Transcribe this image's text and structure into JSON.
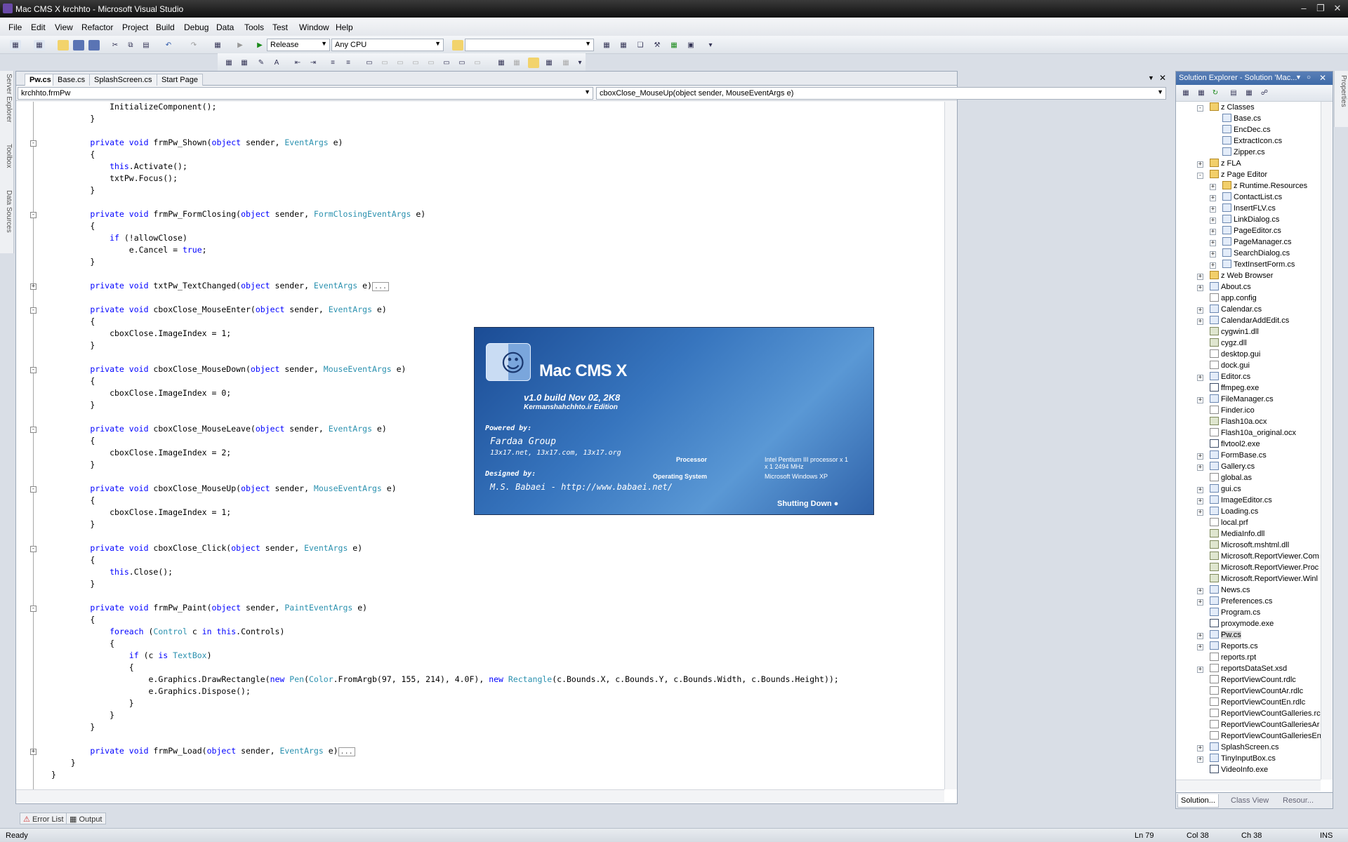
{
  "window": {
    "title": "Mac CMS X krchhto - Microsoft Visual Studio"
  },
  "menu": [
    "File",
    "Edit",
    "View",
    "Refactor",
    "Project",
    "Build",
    "Debug",
    "Data",
    "Tools",
    "Test",
    "Window",
    "Help"
  ],
  "toolbar": {
    "config": "Release",
    "platform": "Any CPU",
    "find": ""
  },
  "side_tabs": [
    "Server Explorer",
    "Toolbox",
    "Data Sources"
  ],
  "document_tabs": [
    "Pw.cs",
    "Base.cs",
    "SplashScreen.cs",
    "Start Page"
  ],
  "navbar": {
    "type": "krchhto.frmPw",
    "member": "cboxClose_MouseUp(object sender, MouseEventArgs e)"
  },
  "code_lines": [
    "            InitializeComponent();",
    "        }",
    "",
    "        private void frmPw_Shown(object sender, EventArgs e)",
    "        {",
    "            this.Activate();",
    "            txtPw.Focus();",
    "        }",
    "",
    "        private void frmPw_FormClosing(object sender, FormClosingEventArgs e)",
    "        {",
    "            if (!allowClose)",
    "                e.Cancel = true;",
    "        }",
    "",
    "        private void txtPw_TextChanged(object sender, EventArgs e)",
    "",
    "        private void cboxClose_MouseEnter(object sender, EventArgs e)",
    "        {",
    "            cboxClose.ImageIndex = 1;",
    "        }",
    "",
    "        private void cboxClose_MouseDown(object sender, MouseEventArgs e)",
    "        {",
    "            cboxClose.ImageIndex = 0;",
    "        }",
    "",
    "        private void cboxClose_MouseLeave(object sender, EventArgs e)",
    "        {",
    "            cboxClose.ImageIndex = 2;",
    "        }",
    "",
    "        private void cboxClose_MouseUp(object sender, MouseEventArgs e)",
    "        {",
    "            cboxClose.ImageIndex = 1;",
    "        }",
    "",
    "        private void cboxClose_Click(object sender, EventArgs e)",
    "        {",
    "            this.Close();",
    "        }",
    "",
    "        private void frmPw_Paint(object sender, PaintEventArgs e)",
    "        {",
    "            foreach (Control c in this.Controls)",
    "            {",
    "                if (c is TextBox)",
    "                {",
    "                    e.Graphics.DrawRectangle(new Pen(Color.FromArgb(97, 155, 214), 4.0F), new Rectangle(c.Bounds.X, c.Bounds.Y, c.Bounds.Width, c.Bounds.Height));",
    "                    e.Graphics.Dispose();",
    "                }",
    "            }",
    "        }",
    "",
    "        private void frmPw_Load(object sender, EventArgs e)",
    "    }",
    "}"
  ],
  "collapsed_marker": "...",
  "splash": {
    "app_name": "Mac CMS X",
    "build": "v1.0 build Nov 02, 2K8",
    "edition": "Kermanshahchhto.ir Edition",
    "powered_by_label": "Powered by:",
    "group": "Fardaa Group",
    "domains": "13x17.net, 13x17.com, 13x17.org",
    "designed_by_label": "Designed by:",
    "designer": "M.S. Babaei - http://www.babaei.net/",
    "processor_label": "Processor",
    "processor": "Intel Pentium III processor x 1",
    "processor_line2": "x 1  2494 MHz",
    "os_label": "Operating System",
    "os": "Microsoft Windows XP",
    "status": "Shutting Down"
  },
  "solution_explorer": {
    "title": "Solution Explorer - Solution 'Mac...",
    "items": [
      {
        "label": "z Classes",
        "type": "folder",
        "level": 1,
        "expander": "minus"
      },
      {
        "label": "Base.cs",
        "type": "cs",
        "level": 2,
        "expander": ""
      },
      {
        "label": "EncDec.cs",
        "type": "cs",
        "level": 2,
        "expander": ""
      },
      {
        "label": "ExtractIcon.cs",
        "type": "cs",
        "level": 2,
        "expander": ""
      },
      {
        "label": "Zipper.cs",
        "type": "cs",
        "level": 2,
        "expander": ""
      },
      {
        "label": "z FLA",
        "type": "folder",
        "level": 1,
        "expander": "plus"
      },
      {
        "label": "z Page Editor",
        "type": "folder",
        "level": 1,
        "expander": "minus"
      },
      {
        "label": "z Runtime.Resources",
        "type": "folder",
        "level": 2,
        "expander": "plus"
      },
      {
        "label": "ContactList.cs",
        "type": "cs",
        "level": 2,
        "expander": "plus"
      },
      {
        "label": "InsertFLV.cs",
        "type": "cs",
        "level": 2,
        "expander": "plus"
      },
      {
        "label": "LinkDialog.cs",
        "type": "cs",
        "level": 2,
        "expander": "plus"
      },
      {
        "label": "PageEditor.cs",
        "type": "cs",
        "level": 2,
        "expander": "plus"
      },
      {
        "label": "PageManager.cs",
        "type": "cs",
        "level": 2,
        "expander": "plus"
      },
      {
        "label": "SearchDialog.cs",
        "type": "cs",
        "level": 2,
        "expander": "plus"
      },
      {
        "label": "TextInsertForm.cs",
        "type": "cs",
        "level": 2,
        "expander": "plus"
      },
      {
        "label": "z Web Browser",
        "type": "folder",
        "level": 1,
        "expander": "plus"
      },
      {
        "label": "About.cs",
        "type": "cs",
        "level": 1,
        "expander": "plus"
      },
      {
        "label": "app.config",
        "type": "file",
        "level": 1,
        "expander": ""
      },
      {
        "label": "Calendar.cs",
        "type": "cs",
        "level": 1,
        "expander": "plus"
      },
      {
        "label": "CalendarAddEdit.cs",
        "type": "cs",
        "level": 1,
        "expander": "plus"
      },
      {
        "label": "cygwin1.dll",
        "type": "dll",
        "level": 1,
        "expander": ""
      },
      {
        "label": "cygz.dll",
        "type": "dll",
        "level": 1,
        "expander": ""
      },
      {
        "label": "desktop.gui",
        "type": "file",
        "level": 1,
        "expander": ""
      },
      {
        "label": "dock.gui",
        "type": "file",
        "level": 1,
        "expander": ""
      },
      {
        "label": "Editor.cs",
        "type": "cs",
        "level": 1,
        "expander": "plus"
      },
      {
        "label": "ffmpeg.exe",
        "type": "exe",
        "level": 1,
        "expander": ""
      },
      {
        "label": "FileManager.cs",
        "type": "cs",
        "level": 1,
        "expander": "plus"
      },
      {
        "label": "Finder.ico",
        "type": "file",
        "level": 1,
        "expander": ""
      },
      {
        "label": "Flash10a.ocx",
        "type": "dll",
        "level": 1,
        "expander": ""
      },
      {
        "label": "Flash10a_original.ocx",
        "type": "file",
        "level": 1,
        "expander": ""
      },
      {
        "label": "flvtool2.exe",
        "type": "exe",
        "level": 1,
        "expander": ""
      },
      {
        "label": "FormBase.cs",
        "type": "cs",
        "level": 1,
        "expander": "plus"
      },
      {
        "label": "Gallery.cs",
        "type": "cs",
        "level": 1,
        "expander": "plus"
      },
      {
        "label": "global.as",
        "type": "file",
        "level": 1,
        "expander": ""
      },
      {
        "label": "gui.cs",
        "type": "cs",
        "level": 1,
        "expander": "plus"
      },
      {
        "label": "ImageEditor.cs",
        "type": "cs",
        "level": 1,
        "expander": "plus"
      },
      {
        "label": "Loading.cs",
        "type": "cs",
        "level": 1,
        "expander": "plus"
      },
      {
        "label": "local.prf",
        "type": "file",
        "level": 1,
        "expander": ""
      },
      {
        "label": "MediaInfo.dll",
        "type": "dll",
        "level": 1,
        "expander": ""
      },
      {
        "label": "Microsoft.mshtml.dll",
        "type": "dll",
        "level": 1,
        "expander": ""
      },
      {
        "label": "Microsoft.ReportViewer.Com",
        "type": "dll",
        "level": 1,
        "expander": ""
      },
      {
        "label": "Microsoft.ReportViewer.Proc",
        "type": "dll",
        "level": 1,
        "expander": ""
      },
      {
        "label": "Microsoft.ReportViewer.Winl",
        "type": "dll",
        "level": 1,
        "expander": ""
      },
      {
        "label": "News.cs",
        "type": "cs",
        "level": 1,
        "expander": "plus"
      },
      {
        "label": "Preferences.cs",
        "type": "cs",
        "level": 1,
        "expander": "plus"
      },
      {
        "label": "Program.cs",
        "type": "cs",
        "level": 1,
        "expander": ""
      },
      {
        "label": "proxymode.exe",
        "type": "exe",
        "level": 1,
        "expander": ""
      },
      {
        "label": "Pw.cs",
        "type": "cs",
        "level": 1,
        "expander": "plus"
      },
      {
        "label": "Reports.cs",
        "type": "cs",
        "level": 1,
        "expander": "plus"
      },
      {
        "label": "reports.rpt",
        "type": "file",
        "level": 1,
        "expander": ""
      },
      {
        "label": "reportsDataSet.xsd",
        "type": "file",
        "level": 1,
        "expander": "plus"
      },
      {
        "label": "ReportViewCount.rdlc",
        "type": "file",
        "level": 1,
        "expander": ""
      },
      {
        "label": "ReportViewCountAr.rdlc",
        "type": "file",
        "level": 1,
        "expander": ""
      },
      {
        "label": "ReportViewCountEn.rdlc",
        "type": "file",
        "level": 1,
        "expander": ""
      },
      {
        "label": "ReportViewCountGalleries.rc",
        "type": "file",
        "level": 1,
        "expander": ""
      },
      {
        "label": "ReportViewCountGalleriesAr",
        "type": "file",
        "level": 1,
        "expander": ""
      },
      {
        "label": "ReportViewCountGalleriesEn",
        "type": "file",
        "level": 1,
        "expander": ""
      },
      {
        "label": "SplashScreen.cs",
        "type": "cs",
        "level": 1,
        "expander": "plus"
      },
      {
        "label": "TinyInputBox.cs",
        "type": "cs",
        "level": 1,
        "expander": "plus"
      },
      {
        "label": "VideoInfo.exe",
        "type": "exe",
        "level": 1,
        "expander": ""
      }
    ],
    "tabs": [
      "Solution...",
      "Class View",
      "Resour..."
    ]
  },
  "properties_tab": "Properties",
  "bottom_tabs": [
    "Error List",
    "Output"
  ],
  "status": {
    "text": "Ready",
    "line": "Ln 79",
    "col": "Col 38",
    "ch": "Ch 38",
    "mode": "INS"
  }
}
